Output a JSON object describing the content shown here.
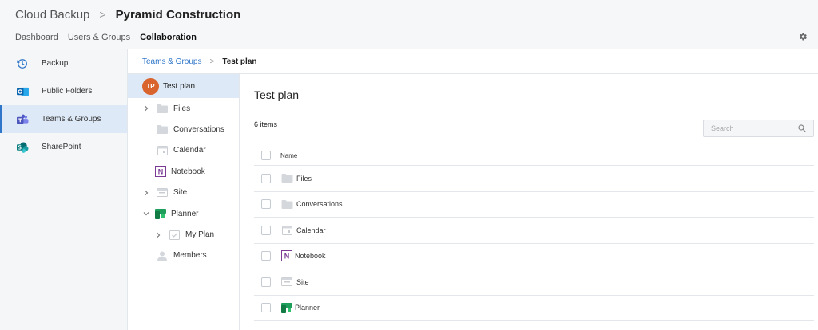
{
  "header": {
    "app_name": "Cloud Backup",
    "separator": ">",
    "org_name": "Pyramid Construction",
    "nav": [
      {
        "label": "Dashboard",
        "active": false
      },
      {
        "label": "Users & Groups",
        "active": false
      },
      {
        "label": "Collaboration",
        "active": true
      }
    ],
    "settings_icon": "gear-icon"
  },
  "sidebar": {
    "items": [
      {
        "label": "Backup",
        "icon": "history-icon",
        "active": false
      },
      {
        "label": "Public Folders",
        "icon": "outlook-icon",
        "active": false
      },
      {
        "label": "Teams & Groups",
        "icon": "teams-icon",
        "active": true
      },
      {
        "label": "SharePoint",
        "icon": "sharepoint-icon",
        "active": false
      }
    ]
  },
  "breadcrumb": {
    "parent": "Teams & Groups",
    "separator": ">",
    "current": "Test plan"
  },
  "tree": {
    "root": {
      "initials": "TP",
      "label": "Test plan"
    },
    "items": [
      {
        "label": "Files",
        "icon": "folder-icon",
        "chevron": "right"
      },
      {
        "label": "Conversations",
        "icon": "folder-icon",
        "chevron": null
      },
      {
        "label": "Calendar",
        "icon": "calendar-icon",
        "chevron": null
      },
      {
        "label": "Notebook",
        "icon": "onenote-icon",
        "chevron": null
      },
      {
        "label": "Site",
        "icon": "site-icon",
        "chevron": "right"
      },
      {
        "label": "Planner",
        "icon": "planner-icon",
        "chevron": "down"
      },
      {
        "label": "My Plan",
        "icon": "plan-icon",
        "chevron": "right"
      },
      {
        "label": "Members",
        "icon": "person-icon",
        "chevron": null
      }
    ]
  },
  "main": {
    "title": "Test plan",
    "item_count": "6 items",
    "search_placeholder": "Search",
    "column_name": "Name",
    "rows": [
      {
        "label": "Files",
        "icon": "folder-icon"
      },
      {
        "label": "Conversations",
        "icon": "folder-icon"
      },
      {
        "label": "Calendar",
        "icon": "calendar-icon"
      },
      {
        "label": "Notebook",
        "icon": "onenote-icon"
      },
      {
        "label": "Site",
        "icon": "site-icon"
      },
      {
        "label": "Planner",
        "icon": "planner-icon"
      }
    ]
  },
  "colors": {
    "accent": "#2f76c9",
    "avatar": "#d9642e",
    "selected_bg": "#dde9f6",
    "planner_green": "#1e9e5a",
    "onenote_purple": "#7b3a96"
  }
}
